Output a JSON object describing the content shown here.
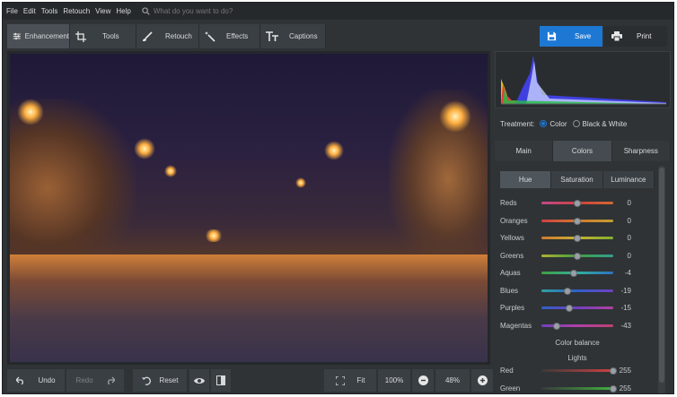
{
  "menu": {
    "items": [
      "File",
      "Edit",
      "Tools",
      "Retouch",
      "View",
      "Help"
    ],
    "search_placeholder": "What do you want to do?"
  },
  "toolbar": {
    "tabs": [
      {
        "label": "Enhancement",
        "icon": "sliders-icon",
        "active": true
      },
      {
        "label": "Tools",
        "icon": "crop-icon",
        "active": false
      },
      {
        "label": "Retouch",
        "icon": "brush-icon",
        "active": false
      },
      {
        "label": "Effects",
        "icon": "magic-wand-icon",
        "active": false
      },
      {
        "label": "Captions",
        "icon": "text-icon",
        "active": false
      }
    ],
    "save_label": "Save",
    "print_label": "Print"
  },
  "bottom": {
    "undo_label": "Undo",
    "redo_label": "Redo",
    "reset_label": "Reset",
    "fit_label": "Fit",
    "zoom_100": "100%",
    "zoom_current": "48%"
  },
  "panel": {
    "treatment_label": "Treatment:",
    "treatment_options": [
      "Color",
      "Black & White"
    ],
    "treatment_selected": "Color",
    "tabs": [
      "Main",
      "Colors",
      "Sharpness"
    ],
    "active_tab": "Colors",
    "subtabs": [
      "Hue",
      "Saturation",
      "Luminance"
    ],
    "active_subtab": "Hue",
    "hue_sliders": [
      {
        "label": "Reds",
        "value": "0"
      },
      {
        "label": "Oranges",
        "value": "0"
      },
      {
        "label": "Yellows",
        "value": "0"
      },
      {
        "label": "Greens",
        "value": "0"
      },
      {
        "label": "Aquas",
        "value": "-4"
      },
      {
        "label": "Blues",
        "value": "-19"
      },
      {
        "label": "Purples",
        "value": "-15"
      },
      {
        "label": "Magentas",
        "value": "-43"
      }
    ],
    "color_balance_title": "Color balance",
    "lights_title": "Lights",
    "balance_sliders": [
      {
        "label": "Red",
        "value": "255"
      },
      {
        "label": "Green",
        "value": "255"
      }
    ]
  },
  "colors": {
    "accent": "#1d78d4",
    "background": "#2f3336"
  }
}
